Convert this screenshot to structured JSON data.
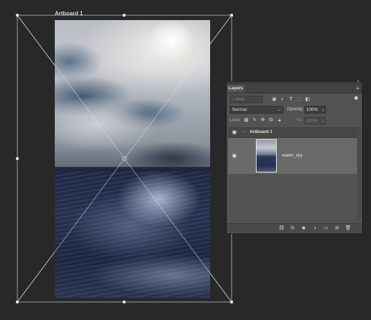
{
  "artboard": {
    "title": "Artboard 1"
  },
  "layers_panel": {
    "tab_label": "Layers",
    "collapse_glyph": "«",
    "menu_glyph": "≡",
    "filter": {
      "kind_placeholder": "Kind",
      "icons": [
        "image-filter-icon",
        "adjustment-filter-icon",
        "type-filter-icon",
        "shape-filter-icon",
        "smart-object-filter-icon"
      ]
    },
    "blend_mode": "Normal",
    "opacity_label": "Opacity:",
    "opacity_value": "100%",
    "lock_label": "Lock:",
    "fill_label": "Fill:",
    "fill_value": "100%",
    "layers": [
      {
        "name": "Artboard 1",
        "type": "artboard",
        "visible": true
      },
      {
        "name": "water_sky",
        "type": "pixel",
        "visible": true
      }
    ],
    "footer_icons": [
      "link-icon",
      "fx-icon",
      "mask-icon",
      "adjustment-layer-icon",
      "group-folder-icon",
      "new-layer-icon",
      "trash-icon"
    ]
  },
  "colors": {
    "canvas_bg": "#282828",
    "panel_bg": "#535353",
    "selected_layer_bg": "#6a6a6a"
  }
}
